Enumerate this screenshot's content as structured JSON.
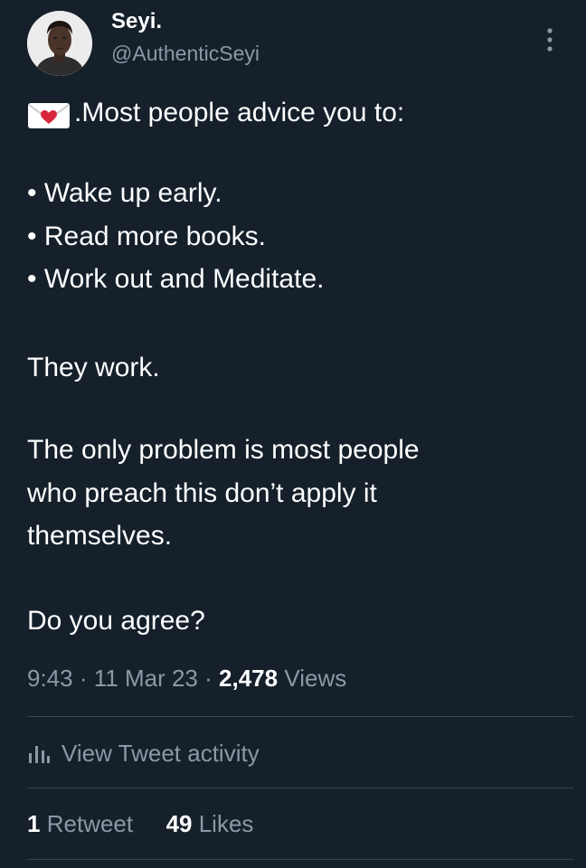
{
  "author": {
    "name": "Seyi.",
    "handle": "@AuthenticSeyi"
  },
  "tweet": {
    "first_line": ".Most people advice you to:",
    "bullets": [
      "Wake up early.",
      "Read more books.",
      "Work out and Meditate."
    ],
    "bullet_glyph": "•",
    "paragraph_1": "They work.",
    "paragraph_2_lines": [
      "The only problem is most people",
      "who preach this don’t apply it",
      "themselves."
    ],
    "paragraph_3": "Do you agree?"
  },
  "meta": {
    "time": "9:43",
    "separator": "·",
    "date": "11 Mar 23",
    "views_count": "2,478",
    "views_label": "Views"
  },
  "activity": {
    "label": "View Tweet activity"
  },
  "stats": {
    "retweets_count": "1",
    "retweets_label": "Retweet",
    "likes_count": "49",
    "likes_label": "Likes"
  },
  "icons": {
    "envelope": "love-letter-icon",
    "more": "more-vertical-icon",
    "activity": "bar-chart-icon"
  },
  "colors": {
    "background": "#15202b",
    "primary_text": "#ffffff",
    "secondary_text": "#8b98a5",
    "divider": "#38444d",
    "envelope_heart": "#d8263a"
  }
}
